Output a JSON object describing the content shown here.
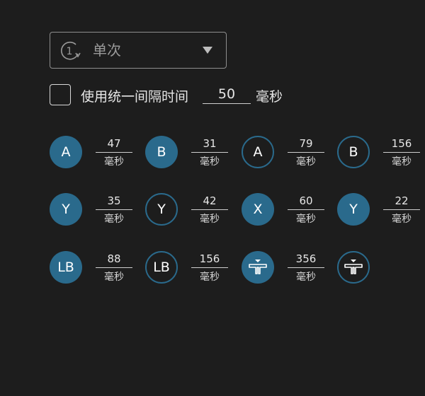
{
  "dropdown": {
    "label": "单次",
    "icon_number": "1"
  },
  "uniform": {
    "label": "使用统一间隔时间",
    "value": "50",
    "unit": "毫秒",
    "checked": false
  },
  "sequence": [
    {
      "button": "A",
      "style": "filled",
      "interval": "47",
      "unit": "毫秒"
    },
    {
      "button": "B",
      "style": "filled",
      "interval": "31",
      "unit": "毫秒"
    },
    {
      "button": "A",
      "style": "outline",
      "interval": "79",
      "unit": "毫秒"
    },
    {
      "button": "B",
      "style": "outline",
      "interval": "156",
      "unit": "毫秒"
    },
    {
      "button": "Y",
      "style": "filled",
      "interval": "35",
      "unit": "毫秒"
    },
    {
      "button": "Y",
      "style": "outline",
      "interval": "42",
      "unit": "毫秒"
    },
    {
      "button": "X",
      "style": "filled",
      "interval": "60",
      "unit": "毫秒"
    },
    {
      "button": "Y",
      "style": "filled",
      "interval": "22",
      "unit": "毫秒"
    },
    {
      "button": "LB",
      "style": "filled",
      "interval": "88",
      "unit": "毫秒"
    },
    {
      "button": "LB",
      "style": "outline",
      "interval": "156",
      "unit": "毫秒"
    },
    {
      "button": "",
      "style": "filled",
      "icon": "trigger-icon",
      "interval": "356",
      "unit": "毫秒"
    },
    {
      "button": "",
      "style": "outline",
      "icon": "trigger-icon"
    }
  ],
  "colors": {
    "background": "#1d1d1d",
    "accent": "#2a6a8c"
  }
}
